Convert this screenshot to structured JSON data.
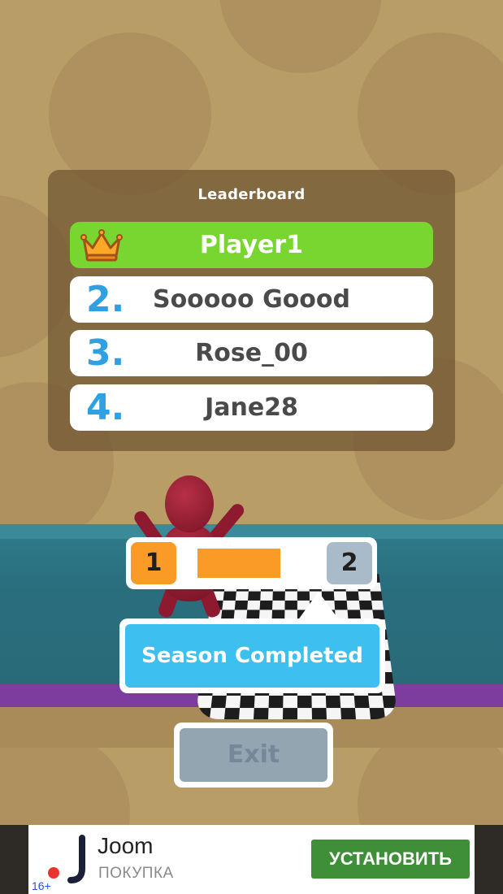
{
  "leaderboard": {
    "title": "Leaderboard",
    "entries": [
      {
        "rank": "",
        "name": "Player1",
        "icon": "crown-icon",
        "highlight_color": "#79d52f"
      },
      {
        "rank": "2.",
        "name": "Sooooo Goood"
      },
      {
        "rank": "3.",
        "name": "Rose_00"
      },
      {
        "rank": "4.",
        "name": "Jane28"
      }
    ]
  },
  "progress": {
    "current_level": "1",
    "next_level": "2",
    "fill_fraction": 0.77,
    "fill_color": "#fb9b27"
  },
  "season_banner": {
    "label": "Season Completed",
    "color": "#3dbfef"
  },
  "exit_button": {
    "label": "Exit"
  },
  "ad": {
    "title": "Joom",
    "subtitle": "ПОКУПКА",
    "install_label": "УСТАНОВИТЬ",
    "age_rating": "16+",
    "button_color": "#3f8f39"
  }
}
